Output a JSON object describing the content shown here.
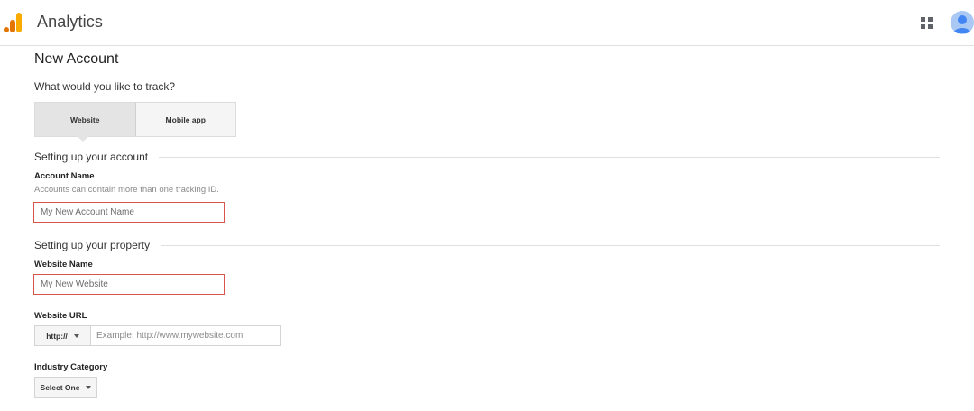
{
  "header": {
    "logo_icon": "analytics-bars-icon",
    "app_title": "Analytics",
    "apps_icon": "apps-grid-icon",
    "avatar_icon": "account-avatar-icon",
    "colors": {
      "logo_orange": "#F9AB00",
      "logo_dark_orange": "#E37400",
      "avatar_bg": "#A9C8F4",
      "avatar_fg": "#4285F4"
    }
  },
  "page": {
    "title": "New Account"
  },
  "track": {
    "question": "What would you like to track?",
    "options": [
      {
        "label": "Website",
        "selected": true
      },
      {
        "label": "Mobile app",
        "selected": false
      }
    ]
  },
  "account": {
    "section_title": "Setting up your account",
    "name_label": "Account Name",
    "name_help": "Accounts can contain more than one tracking ID.",
    "name_placeholder": "My New Account Name"
  },
  "property": {
    "section_title": "Setting up your property",
    "website_name_label": "Website Name",
    "website_name_placeholder": "My New Website",
    "website_url_label": "Website URL",
    "protocol_selected": "http://",
    "url_placeholder": "Example: http://www.mywebsite.com",
    "industry_label": "Industry Category",
    "industry_selected": "Select One"
  },
  "colors": {
    "error_border": "#D9534F",
    "divider": "#E0E0E0",
    "button_bg": "#F5F5F5",
    "selected_bg": "#E4E4E4"
  }
}
